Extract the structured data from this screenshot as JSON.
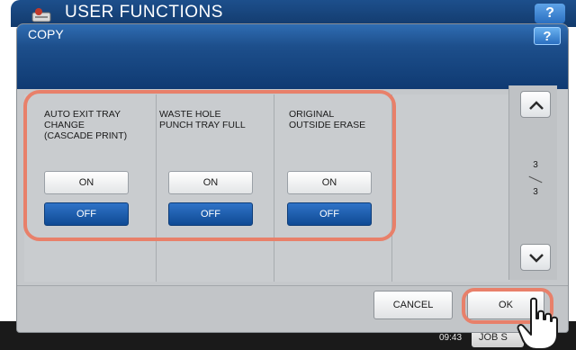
{
  "background_app": {
    "title": "USER FUNCTIONS",
    "help_label": "?",
    "clock": "09:43",
    "job_status_label": "JOB S"
  },
  "dialog": {
    "title": "COPY",
    "help_label": "?"
  },
  "settings": [
    {
      "label": "AUTO EXIT TRAY\nCHANGE\n(CASCADE PRINT)",
      "on_label": "ON",
      "off_label": "OFF",
      "selected": "OFF"
    },
    {
      "label": "WASTE HOLE\nPUNCH TRAY FULL",
      "on_label": "ON",
      "off_label": "OFF",
      "selected": "OFF"
    },
    {
      "label": "ORIGINAL\nOUTSIDE ERASE",
      "on_label": "ON",
      "off_label": "OFF",
      "selected": "OFF"
    }
  ],
  "pager": {
    "current": "3",
    "total": "3"
  },
  "footer": {
    "cancel_label": "CANCEL",
    "ok_label": "OK"
  },
  "colors": {
    "accent_blue": "#1d4f8c",
    "selected_button": "#1a5aa8",
    "highlight": "#e8806a"
  },
  "icons": {
    "scroll_up": "chevron-up-icon",
    "scroll_down": "chevron-down-icon",
    "pointer": "hand-pointer-icon"
  }
}
